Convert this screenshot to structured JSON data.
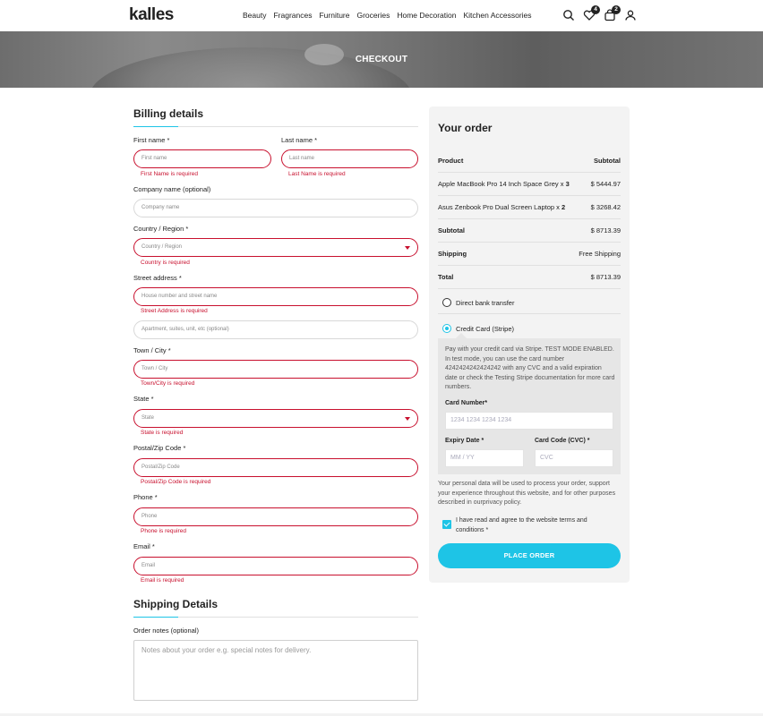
{
  "header": {
    "logo": "kalles",
    "nav": [
      "Beauty",
      "Fragrances",
      "Furniture",
      "Groceries",
      "Home Decoration",
      "Kitchen Accessories"
    ],
    "wishlist_count": "4",
    "cart_count": "2",
    "icons": [
      "search-icon",
      "heart-icon",
      "bag-icon",
      "user-icon"
    ]
  },
  "banner": {
    "title": "CHECKOUT"
  },
  "billing": {
    "title": "Billing details",
    "first_name": {
      "label": "First name *",
      "placeholder": "First name",
      "error": "First Name is required"
    },
    "last_name": {
      "label": "Last name *",
      "placeholder": "Last name",
      "error": "Last Name is required"
    },
    "company": {
      "label": "Company name (optional)",
      "placeholder": "Company name"
    },
    "country": {
      "label": "Country / Region *",
      "placeholder": "Country / Region",
      "error": "Country is required"
    },
    "street": {
      "label": "Street address *",
      "placeholder": "House number and street name",
      "error": "Street Address is required",
      "placeholder2": "Apartment, suites, unit, etc (optional)"
    },
    "town": {
      "label": "Town / City *",
      "placeholder": "Town / City",
      "error": "Town/City is required"
    },
    "state": {
      "label": "State *",
      "placeholder": "State",
      "error": "State is required"
    },
    "postal": {
      "label": "Postal/Zip Code *",
      "placeholder": "Postal/Zip Code",
      "error": "Postal/Zip Code is required"
    },
    "phone": {
      "label": "Phone *",
      "placeholder": "Phone",
      "error": "Phone is required"
    },
    "email": {
      "label": "Email *",
      "placeholder": "Email",
      "error": "Email is required"
    }
  },
  "shipping": {
    "title": "Shipping Details",
    "notes_label": "Order notes (optional)",
    "notes_placeholder": "Notes about your order e.g. special notes for delivery."
  },
  "order": {
    "title": "Your order",
    "col_product": "Product",
    "col_subtotal": "Subtotal",
    "items": [
      {
        "name": "Apple MacBook Pro 14 Inch Space Grey x",
        "qty": "3",
        "price": "$ 5444.97"
      },
      {
        "name": "Asus Zenbook Pro Dual Screen Laptop x",
        "qty": "2",
        "price": "$ 3268.42"
      }
    ],
    "subtotal_label": "Subtotal",
    "subtotal_value": "$ 8713.39",
    "shipping_label": "Shipping",
    "shipping_value": "Free Shipping",
    "total_label": "Total",
    "total_value": "$ 8713.39",
    "payment_bank": "Direct bank transfer",
    "payment_stripe": "Credit Card (Stripe)",
    "stripe_desc": "Pay with your credit card via Stripe. TEST MODE ENABLED. In test mode, you can use the card number 4242424242424242 with any CVC and a valid expiration date or check the Testing Stripe documentation for more card numbers.",
    "card_number_label": "Card Number*",
    "card_number_placeholder": "1234 1234 1234 1234",
    "expiry_label": "Expiry Date *",
    "expiry_placeholder": "MM / YY",
    "cvc_label": "Card Code (CVC) *",
    "cvc_placeholder": "CVC",
    "privacy": "Your personal data will be used to process your order, support your experience throughout this website, and for other purposes described in ourprivacy policy.",
    "agree": "I have read and agree to the website terms and conditions *",
    "place_order": "PLACE ORDER"
  }
}
